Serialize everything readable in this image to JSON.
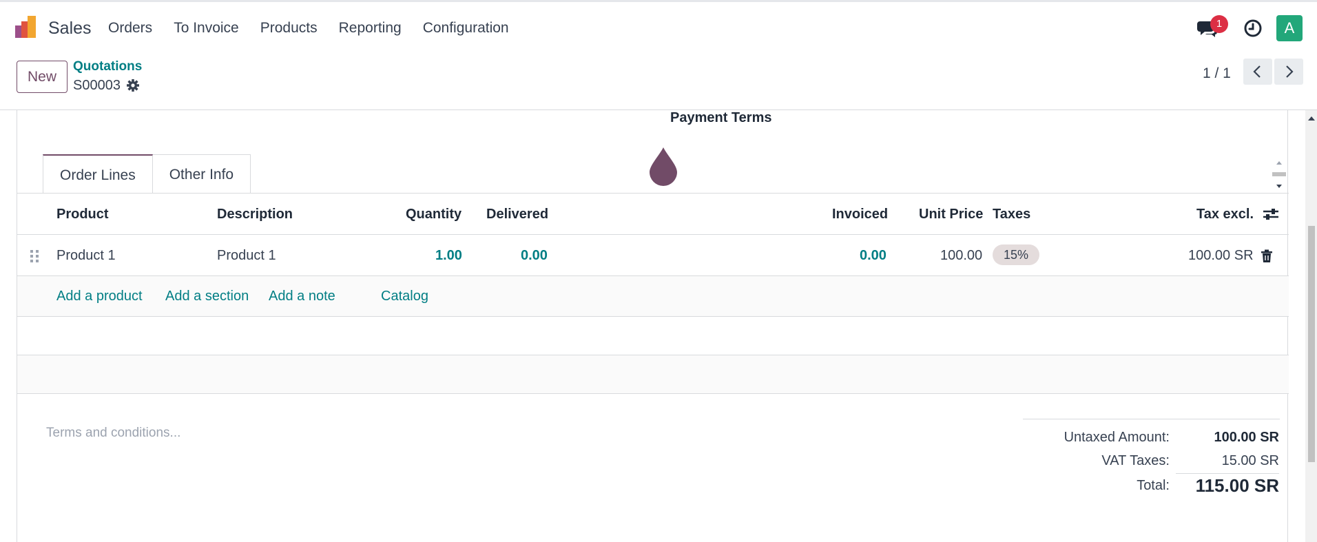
{
  "navbar": {
    "app_name": "Sales",
    "menu": [
      "Orders",
      "To Invoice",
      "Products",
      "Reporting",
      "Configuration"
    ],
    "message_count": "1",
    "avatar_letter": "A",
    "colors": {
      "badge": "#dc2f44",
      "avatar": "#22a77a"
    }
  },
  "control": {
    "new_label": "New",
    "breadcrumb_parent": "Quotations",
    "breadcrumb_current": "S00003",
    "pager": "1 / 1"
  },
  "sheet": {
    "payment_terms_label": "Payment Terms",
    "tabs": [
      "Order Lines",
      "Other Info"
    ],
    "columns": {
      "product": "Product",
      "description": "Description",
      "quantity": "Quantity",
      "delivered": "Delivered",
      "invoiced": "Invoiced",
      "unit_price": "Unit Price",
      "taxes": "Taxes",
      "tax_excl": "Tax excl."
    },
    "lines": [
      {
        "product": "Product 1",
        "description": "Product 1",
        "quantity": "1.00",
        "delivered": "0.00",
        "invoiced": "0.00",
        "unit_price": "100.00",
        "taxes": "15%",
        "tax_excl": "100.00 SR"
      }
    ],
    "add_links": {
      "add_product": "Add a product",
      "add_section": "Add a section",
      "add_note": "Add a note",
      "catalog": "Catalog"
    },
    "terms_placeholder": "Terms and conditions...",
    "totals": {
      "untaxed_label": "Untaxed Amount:",
      "untaxed_value": "100.00 SR",
      "vat_label": "VAT Taxes:",
      "vat_value": "15.00 SR",
      "total_label": "Total:",
      "total_value": "115.00 SR"
    },
    "accent_color": "#714b67",
    "link_color": "#017e84"
  }
}
